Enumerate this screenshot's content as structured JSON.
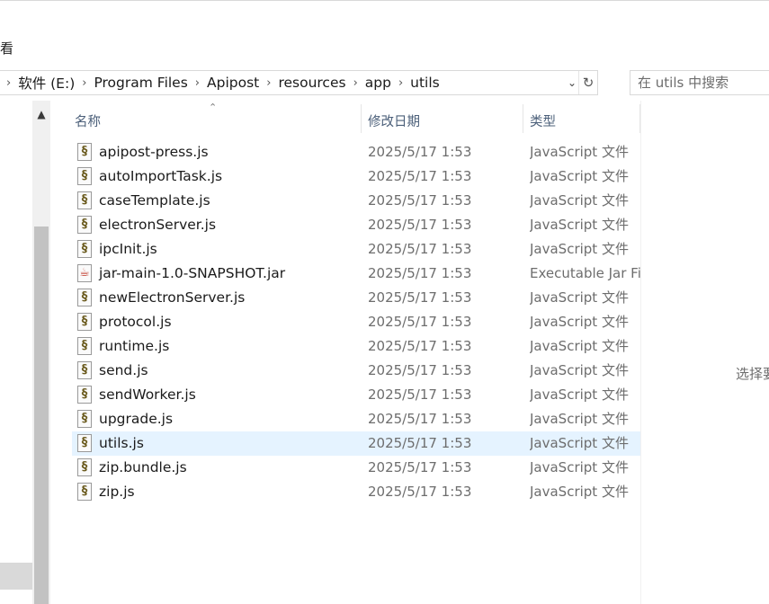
{
  "ribbon": {
    "view_label": "看"
  },
  "address": {
    "crumbs": [
      "软件 (E:)",
      "Program Files",
      "Apipost",
      "resources",
      "app",
      "utils"
    ],
    "dropdown_icon": "chevron-down-icon",
    "refresh_icon": "refresh-icon"
  },
  "search": {
    "placeholder": "在 utils 中搜索"
  },
  "columns": {
    "name": "名称",
    "date": "修改日期",
    "type": "类型"
  },
  "files": [
    {
      "name": "apipost-press.js",
      "date": "2025/5/17 1:53",
      "type": "JavaScript 文件",
      "icon": "js"
    },
    {
      "name": "autoImportTask.js",
      "date": "2025/5/17 1:53",
      "type": "JavaScript 文件",
      "icon": "js"
    },
    {
      "name": "caseTemplate.js",
      "date": "2025/5/17 1:53",
      "type": "JavaScript 文件",
      "icon": "js"
    },
    {
      "name": "electronServer.js",
      "date": "2025/5/17 1:53",
      "type": "JavaScript 文件",
      "icon": "js"
    },
    {
      "name": "ipcInit.js",
      "date": "2025/5/17 1:53",
      "type": "JavaScript 文件",
      "icon": "js"
    },
    {
      "name": "jar-main-1.0-SNAPSHOT.jar",
      "date": "2025/5/17 1:53",
      "type": "Executable Jar File",
      "icon": "jar"
    },
    {
      "name": "newElectronServer.js",
      "date": "2025/5/17 1:53",
      "type": "JavaScript 文件",
      "icon": "js"
    },
    {
      "name": "protocol.js",
      "date": "2025/5/17 1:53",
      "type": "JavaScript 文件",
      "icon": "js"
    },
    {
      "name": "runtime.js",
      "date": "2025/5/17 1:53",
      "type": "JavaScript 文件",
      "icon": "js"
    },
    {
      "name": "send.js",
      "date": "2025/5/17 1:53",
      "type": "JavaScript 文件",
      "icon": "js"
    },
    {
      "name": "sendWorker.js",
      "date": "2025/5/17 1:53",
      "type": "JavaScript 文件",
      "icon": "js"
    },
    {
      "name": "upgrade.js",
      "date": "2025/5/17 1:53",
      "type": "JavaScript 文件",
      "icon": "js"
    },
    {
      "name": "utils.js",
      "date": "2025/5/17 1:53",
      "type": "JavaScript 文件",
      "icon": "js",
      "selected": true
    },
    {
      "name": "zip.bundle.js",
      "date": "2025/5/17 1:53",
      "type": "JavaScript 文件",
      "icon": "js"
    },
    {
      "name": "zip.js",
      "date": "2025/5/17 1:53",
      "type": "JavaScript 文件",
      "icon": "js"
    }
  ],
  "preview": {
    "text": "选择要"
  },
  "colors": {
    "selected_row": "#e5f3ff",
    "header_text": "#4c607a",
    "muted_text": "#6d6d6d"
  }
}
